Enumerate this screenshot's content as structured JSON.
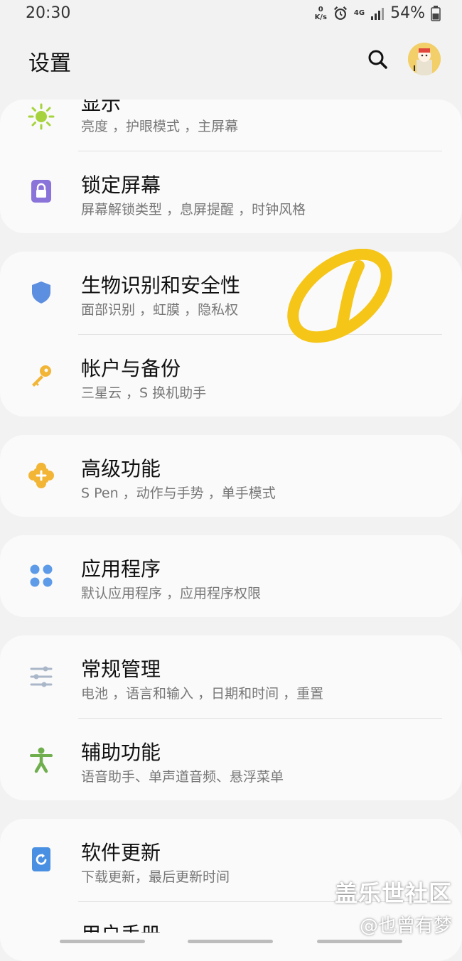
{
  "status_bar": {
    "time": "20:30",
    "net_speed_value": "0",
    "net_speed_unit": "K/s",
    "network_type": "4G",
    "battery": "54%",
    "icons": [
      "alarm-icon",
      "signal-icon",
      "battery-icon"
    ]
  },
  "header": {
    "title": "设置",
    "search_icon": "search-icon",
    "avatar": "avatar"
  },
  "settings": {
    "display": {
      "title": "显示",
      "subtitle": "亮度 ，护眼模式 ，主屏幕",
      "icon": "sun-icon",
      "color": "#a6d33d"
    },
    "lock_screen": {
      "title": "锁定屏幕",
      "subtitle": "屏幕解锁类型 ，息屏提醒 ，时钟风格",
      "icon": "lock-icon",
      "color": "#8a73d9"
    },
    "biometrics": {
      "title": "生物识别和安全性",
      "subtitle": "面部识别 ，虹膜 ，隐私权",
      "icon": "shield-icon",
      "color": "#5d8fe0"
    },
    "accounts": {
      "title": "帐户与备份",
      "subtitle": "三星云 ，S 换机助手",
      "icon": "key-icon",
      "color": "#f2b535"
    },
    "advanced": {
      "title": "高级功能",
      "subtitle": "S Pen ，动作与手势 ，单手模式",
      "icon": "puzzle-icon",
      "color": "#f2b535"
    },
    "apps": {
      "title": "应用程序",
      "subtitle": "默认应用程序 ，应用程序权限",
      "icon": "apps-icon",
      "color": "#5d9be8"
    },
    "general": {
      "title": "常规管理",
      "subtitle": "电池 ，语言和输入 ，日期和时间 ，重置",
      "icon": "sliders-icon",
      "color": "#a9b7c9"
    },
    "accessibility": {
      "title": "辅助功能",
      "subtitle": "语音助手、单声道音频、悬浮菜单",
      "icon": "accessibility-icon",
      "color": "#6fae4c"
    },
    "software_update": {
      "title": "软件更新",
      "subtitle": "下载更新，最后更新时间",
      "icon": "update-icon",
      "color": "#4a90e2"
    },
    "user_manual": {
      "title": "用户手册"
    }
  },
  "watermark": {
    "line1": "盖乐世社区",
    "line2": "@也曾有梦"
  },
  "annotation_color": "#f5c518"
}
